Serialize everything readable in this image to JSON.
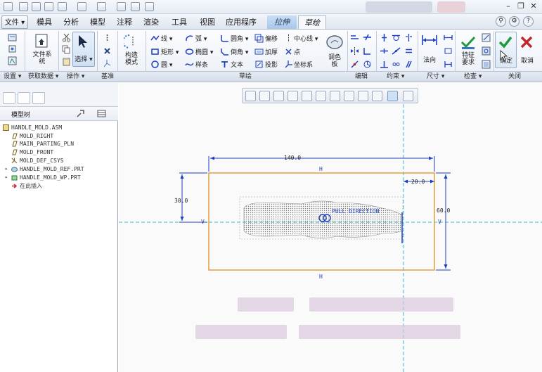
{
  "ribbon": {
    "file_tab": "文件",
    "tabs": [
      "模具",
      "分析",
      "模型",
      "注释",
      "渲染",
      "工具",
      "视图",
      "应用程序"
    ],
    "context_tabs": [
      "拉伸",
      "草绘"
    ],
    "active_tab": "草绘"
  },
  "groups": {
    "setup": "设置",
    "get_data": "获取数据",
    "operations": "操作",
    "datum": "基准",
    "sketch": "草绘",
    "edit": "编辑",
    "constrain": "约束",
    "dimension": "尺寸",
    "inspect": "检查",
    "close": "关闭"
  },
  "buttons": {
    "file_system": "文件系统",
    "select": "选择",
    "construction_mode_1": "构造",
    "construction_mode_2": "模式",
    "line": "线",
    "arc": "弧",
    "fillet": "圆角",
    "offset": "偏移",
    "centerline": "中心线",
    "rectangle": "矩形",
    "ellipse": "椭圆",
    "chamfer": "倒角",
    "thicken": "加厚",
    "point": "点",
    "circle": "圆",
    "spline": "样条",
    "text": "文本",
    "project": "投影",
    "coordinate_system": "坐标系",
    "palette_1": "调色",
    "palette_2": "板",
    "normal": "法向",
    "feature_req_1": "特征",
    "feature_req_2": "要求",
    "ok": "确定",
    "cancel": "取消"
  },
  "model_tree": {
    "title": "模型树",
    "items": [
      "HANDLE_MOLD.ASM",
      "MOLD_RIGHT",
      "MAIN_PARTING_PLN",
      "MOLD_FRONT",
      "MOLD_DEF_CSYS",
      "HANDLE_MOLD_REF.PRT",
      "HANDLE_MOLD_WP.PRT",
      "在此插入"
    ]
  },
  "sketch": {
    "dim_width": "140.0",
    "dim_height": "60.0",
    "dim_left": "30.0",
    "dim_right": "20.0",
    "label_pull": "PULL DIRECTION",
    "h_top": "H",
    "h_bottom": "H",
    "v_left": "V",
    "v_right": "V"
  },
  "colors": {
    "accent_blue": "#3a73c8",
    "sketch_orange": "#e39a2a",
    "dimension_blue": "#1d3fbf",
    "axis_cyan": "#39b8c8",
    "ok_green": "#1e9b3c",
    "cancel_red": "#c0272d"
  }
}
